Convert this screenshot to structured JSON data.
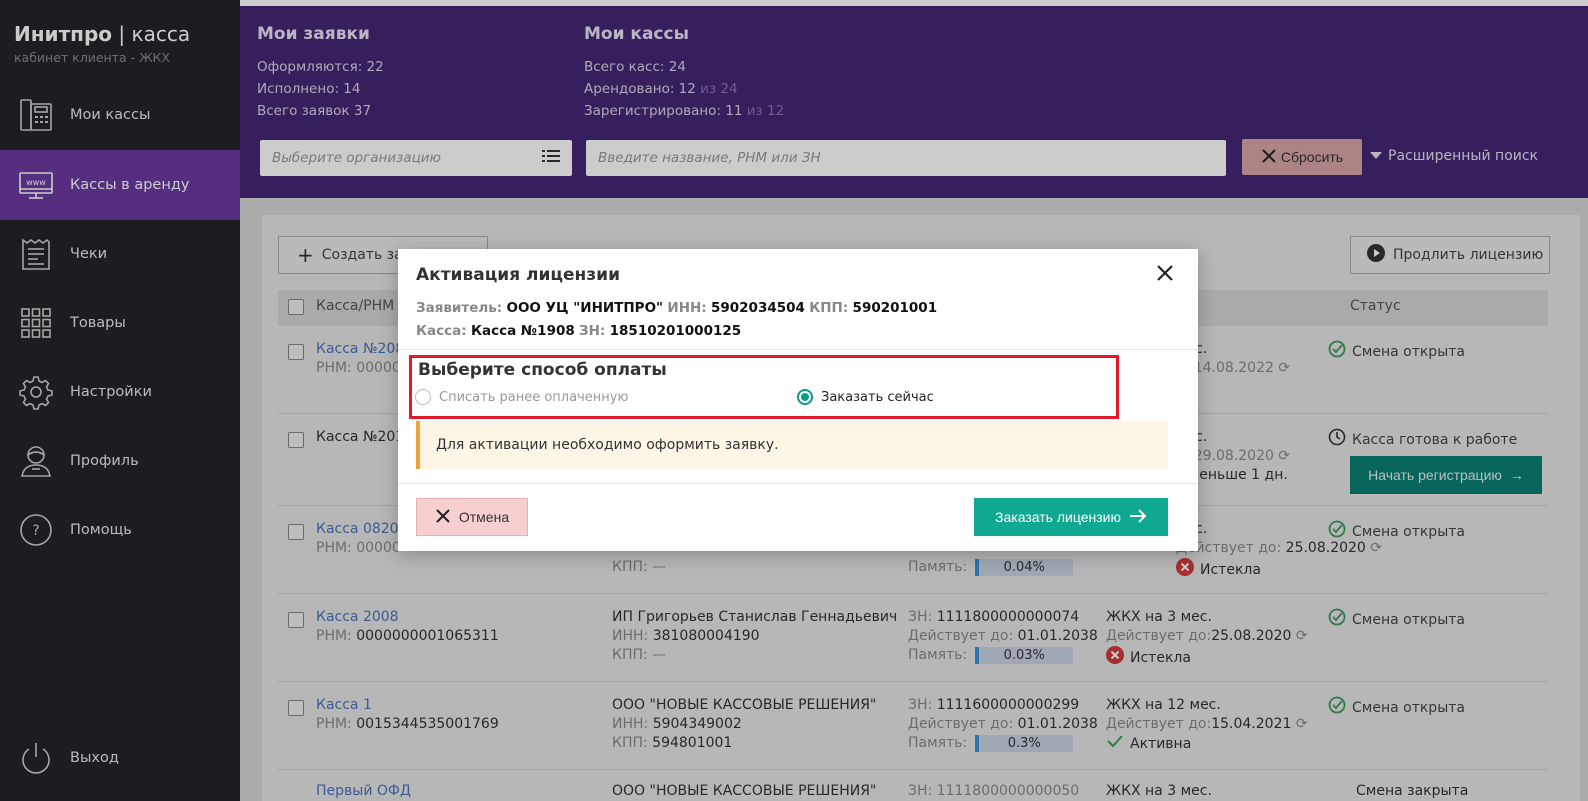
{
  "brand": {
    "name": "Инитпро",
    "sep": " | ",
    "product": "касса",
    "subtitle": "кабинет клиента - ЖКХ"
  },
  "sidebar": {
    "items": [
      {
        "label": "Мои кассы",
        "icon": "cash-register-icon"
      },
      {
        "label": "Кассы в аренду",
        "icon": "monitor-www-icon"
      },
      {
        "label": "Чеки",
        "icon": "receipt-icon"
      },
      {
        "label": "Товары",
        "icon": "grid-icon"
      },
      {
        "label": "Настройки",
        "icon": "gear-icon"
      },
      {
        "label": "Профиль",
        "icon": "user-icon"
      },
      {
        "label": "Помощь",
        "icon": "help-icon"
      }
    ],
    "logout": "Выход"
  },
  "header": {
    "requests": {
      "title": "Мои заявки",
      "processing": "Оформляются: 22",
      "done": "Исполнено: 14",
      "total": "Всего заявок 37"
    },
    "kassas": {
      "title": "Мои кассы",
      "total": "Всего касс: 24",
      "rented": "Арендовано: 12",
      "rented_of": " из 24",
      "registered": "Зарегистрировано: 11",
      "registered_of": " из 12"
    },
    "org_placeholder": "Выберите организацию",
    "search_placeholder": "Введите название, РНМ или ЗН",
    "reset_label": "Сбросить",
    "advanced_label": "Расширенный поиск"
  },
  "toolbar": {
    "create_label": "Создать за",
    "extend_label": "Продлить лицензию"
  },
  "table": {
    "col_kassa": "Касса/РНМ",
    "col_status": "Статус",
    "rows": [
      {
        "name": "Касса №208",
        "rnm": "РНМ: 00000",
        "tariff": "мес.",
        "valid": "о: 14.08.2022",
        "status": "Смена открыта"
      },
      {
        "name": "Касса №201",
        "rnm": "",
        "tariff": "мес.",
        "valid": "о: 29.08.2020",
        "extra": "ь меньше 1 дн.",
        "status": "Касса готова к работе",
        "action": "Начать регистрацию"
      },
      {
        "name": "Касса 08202",
        "rnm": "РНМ: 00000",
        "org_kpp": "КПП: —",
        "mem_label": "Память:",
        "mem": "0.04%",
        "tariff": "мес.",
        "valid_lbl": "Действует до:",
        "valid_val": "25.08.2020",
        "state": "Истекла",
        "status": "Смена открыта"
      },
      {
        "name": "Касса 2008",
        "rnm_lbl": "РНМ:",
        "rnm_val": "0000000001065311",
        "org": "ИП Григорьев Станислав Геннадьевич",
        "inn_lbl": "ИНН:",
        "inn_val": "381080004190",
        "kpp": "КПП: —",
        "zn_lbl": "ЗН:",
        "zn_val": "1111800000000074",
        "act_lbl": "Действует до:",
        "act_val": "01.01.2038",
        "mem_label": "Память:",
        "mem": "0.03%",
        "tariff": "ЖКХ на 3 мес.",
        "valid_lbl": "Действует до:",
        "valid_val": "25.08.2020",
        "state": "Истекла",
        "status": "Смена открыта"
      },
      {
        "name": "Касса 1",
        "rnm_lbl": "РНМ:",
        "rnm_val": "0015344535001769",
        "org": "ООО \"НОВЫЕ КАССОВЫЕ РЕШЕНИЯ\"",
        "inn_lbl": "ИНН:",
        "inn_val": "5904349002",
        "kpp_lbl": "КПП:",
        "kpp_val": "594801001",
        "zn_lbl": "ЗН:",
        "zn_val": "1111600000000299",
        "act_lbl": "Действует до:",
        "act_val": "01.01.2038",
        "mem_label": "Память:",
        "mem": "0.3%",
        "tariff": "ЖКХ на 12 мес.",
        "valid_lbl": "Действует до:",
        "valid_val": "15.04.2021",
        "state": "Активна",
        "status": "Смена открыта"
      }
    ],
    "partial_row": {
      "name": "Первый ОФД",
      "org": "ООО \"НОВЫЕ КАССОВЫЕ РЕШЕНИЯ\"",
      "zn": "ЗН: 1111800000000050",
      "tariff": "ЖКХ на 3 мес.",
      "status": "Смена закрыта"
    }
  },
  "modal": {
    "title": "Активация лицензии",
    "applicant_lbl": "Заявитель:",
    "applicant": "ООО УЦ \"ИНИТПРО\"",
    "inn_lbl": "ИНН:",
    "inn": "5902034504",
    "kpp_lbl": "КПП:",
    "kpp": "590201001",
    "kassa_lbl": "Касса:",
    "kassa": "Касса №1908",
    "zn_lbl": "ЗН:",
    "zn": "18510201000125",
    "pay_title": "Выберите способ оплаты",
    "option_prepaid": "Списать ранее оплаченную",
    "option_order": "Заказать сейчас",
    "selected_option": "order",
    "notice": "Для активации необходимо оформить заявку.",
    "cancel_label": "Отмена",
    "order_label": "Заказать лицензию"
  }
}
